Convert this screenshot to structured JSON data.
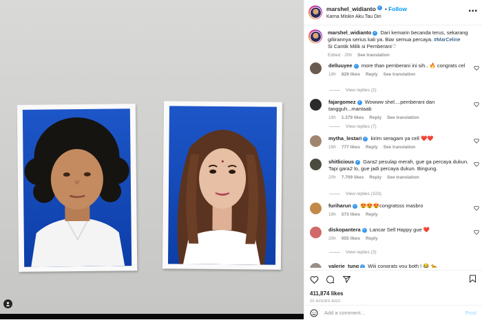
{
  "post": {
    "username": "marshel_widianto",
    "follow_label": "Follow",
    "subtitle": "Karna Miskin Aku Tau Diri",
    "more_label": "•••"
  },
  "caption": {
    "username": "marshel_widianto",
    "text": "Dari kemarin becanda terus, sekarang giliirannya serius kali ya. Biar semua percaya.",
    "hashtag": "#MarCeline",
    "text2": "Si Cantik Milik si Pemberani",
    "edited": "Edited · 20h",
    "see_translation": "See translation"
  },
  "comments": [
    {
      "username": "delluuyee",
      "text": "more than pemberani ini sih.. 🔥 congrats cel",
      "time": "19h",
      "likes": "829 likes",
      "reply": "Reply",
      "see_translation": "See translation",
      "replies": "View replies (2)",
      "avatar_color": "#6b5a4e"
    },
    {
      "username": "fajargomez",
      "text": "Wowww shel....pemberani dan tangguh...mantaab",
      "time": "19h",
      "likes": "1.379 likes",
      "reply": "Reply",
      "see_translation": "See translation",
      "replies": "View replies (7)",
      "avatar_color": "#2b2b2b"
    },
    {
      "username": "mytha_lestari",
      "text": "kirim seragam ya cell ❤️❤️",
      "time": "19h",
      "likes": "777 likes",
      "reply": "Reply",
      "see_translation": "See translation",
      "replies": "",
      "avatar_color": "#a08570"
    },
    {
      "username": "shitlicious",
      "text": "Gara2 pesulap merah, gue ga percaya dukun. Tapi gara2 lo, gue jadi percaya dukun. Bingung.",
      "time": "20h",
      "likes": "7.709 likes",
      "reply": "Reply",
      "see_translation": "See translation",
      "replies": "View replies (323)",
      "avatar_color": "#4a4a3e"
    },
    {
      "username": "furiharun",
      "text": "😍😍😍congratsss masbro",
      "time": "19h",
      "likes": "573 likes",
      "reply": "Reply",
      "see_translation": "",
      "replies": "",
      "avatar_color": "#c28a4a"
    },
    {
      "username": "diskopantera",
      "text": "Lancar Sell Happy gue ❤️",
      "time": "20h",
      "likes": "955 likes",
      "reply": "Reply",
      "see_translation": "",
      "replies": "View replies (3)",
      "avatar_color": "#d16a6a"
    },
    {
      "username": "valerie_tung",
      "text": "Wiii congrats you both ! 😂 🐆",
      "time": "",
      "likes": "",
      "reply": "",
      "see_translation": "",
      "replies": "",
      "avatar_color": "#9a8f86"
    }
  ],
  "actions": {
    "likes": "411,874 likes",
    "ago": "20 HOURS AGO",
    "add_comment_placeholder": "Add a comment…",
    "post_label": "Post"
  },
  "icons": {
    "heart": "heart-icon",
    "comment": "comment-icon",
    "share": "share-icon",
    "save": "bookmark-icon",
    "smile": "emoji-icon"
  },
  "colors": {
    "link_blue": "#0095f6",
    "verified": "#3897f0",
    "text": "#262626",
    "muted": "#8e8e8e"
  }
}
